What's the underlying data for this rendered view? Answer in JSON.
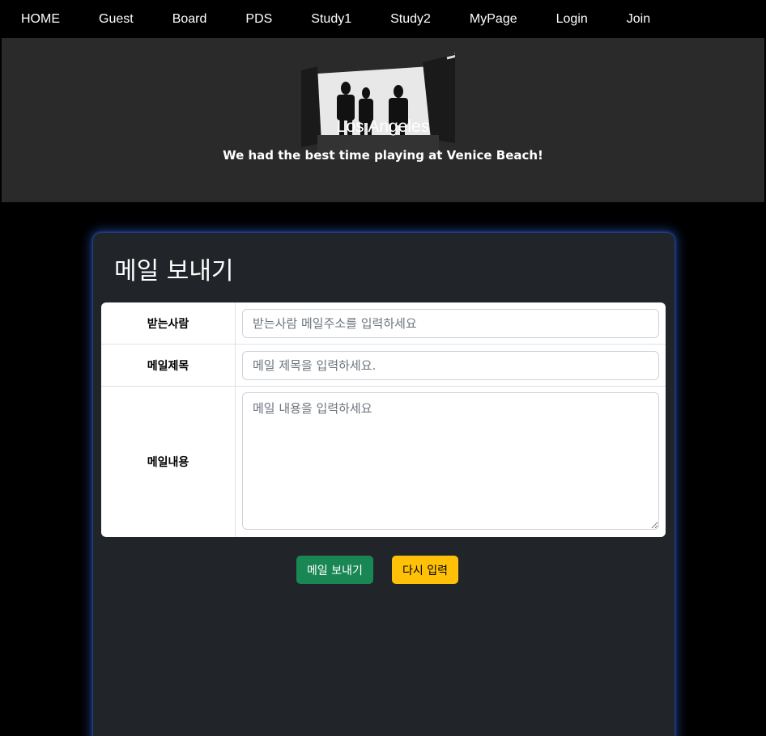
{
  "nav": {
    "items": [
      "HOME",
      "Guest",
      "Board",
      "PDS",
      "Study1",
      "Study2",
      "MyPage",
      "Login",
      "Join"
    ]
  },
  "hero": {
    "title": "Los Angeles",
    "subtitle": "We had the best time playing at Venice Beach!"
  },
  "form": {
    "heading": "메일 보내기",
    "to_label": "받는사람",
    "to_placeholder": "받는사람 메일주소를 입력하세요",
    "subject_label": "메일제목",
    "subject_placeholder": "메일 제목을 입력하세요.",
    "content_label": "메일내용",
    "content_placeholder": "메일 내용을 입력하세요",
    "send_label": "메일 보내기",
    "reset_label": "다시 입력"
  },
  "colors": {
    "send_button": "#198754",
    "reset_button": "#ffc107",
    "card_bg": "#212529",
    "card_glow": "#2855c8"
  }
}
